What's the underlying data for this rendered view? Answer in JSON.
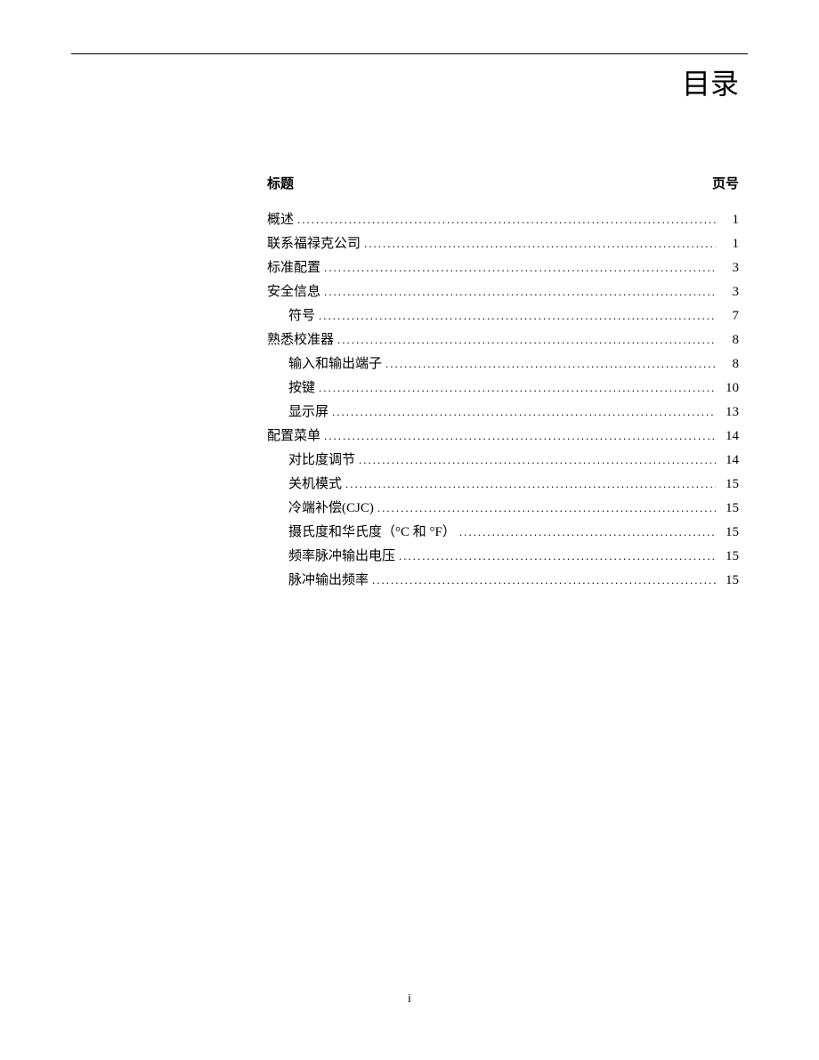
{
  "header": {
    "title": "目录"
  },
  "toc": {
    "col_title": "标题",
    "col_page": "页号",
    "entries": [
      {
        "level": 1,
        "title": "概述",
        "page": "1"
      },
      {
        "level": 1,
        "title": "联系福禄克公司",
        "page": "1"
      },
      {
        "level": 1,
        "title": "标准配置",
        "page": "3"
      },
      {
        "level": 1,
        "title": "安全信息",
        "page": "3"
      },
      {
        "level": 2,
        "title": "符号",
        "page": "7"
      },
      {
        "level": 1,
        "title": "熟悉校准器",
        "page": "8"
      },
      {
        "level": 2,
        "title": "输入和输出端子",
        "page": "8"
      },
      {
        "level": 2,
        "title": "按键",
        "page": "10"
      },
      {
        "level": 2,
        "title": "显示屏",
        "page": "13"
      },
      {
        "level": 1,
        "title": "配置菜单",
        "page": "14"
      },
      {
        "level": 2,
        "title": "对比度调节",
        "page": "14"
      },
      {
        "level": 2,
        "title": "关机模式",
        "page": "15"
      },
      {
        "level": 2,
        "title": "冷端补偿(CJC)",
        "page": "15"
      },
      {
        "level": 2,
        "title": "摄氏度和华氏度（°C 和 °F）",
        "page": "15"
      },
      {
        "level": 2,
        "title": "频率脉冲输出电压",
        "page": "15"
      },
      {
        "level": 2,
        "title": "脉冲输出频率",
        "page": "15"
      }
    ]
  },
  "footer": {
    "page_number": "i"
  }
}
